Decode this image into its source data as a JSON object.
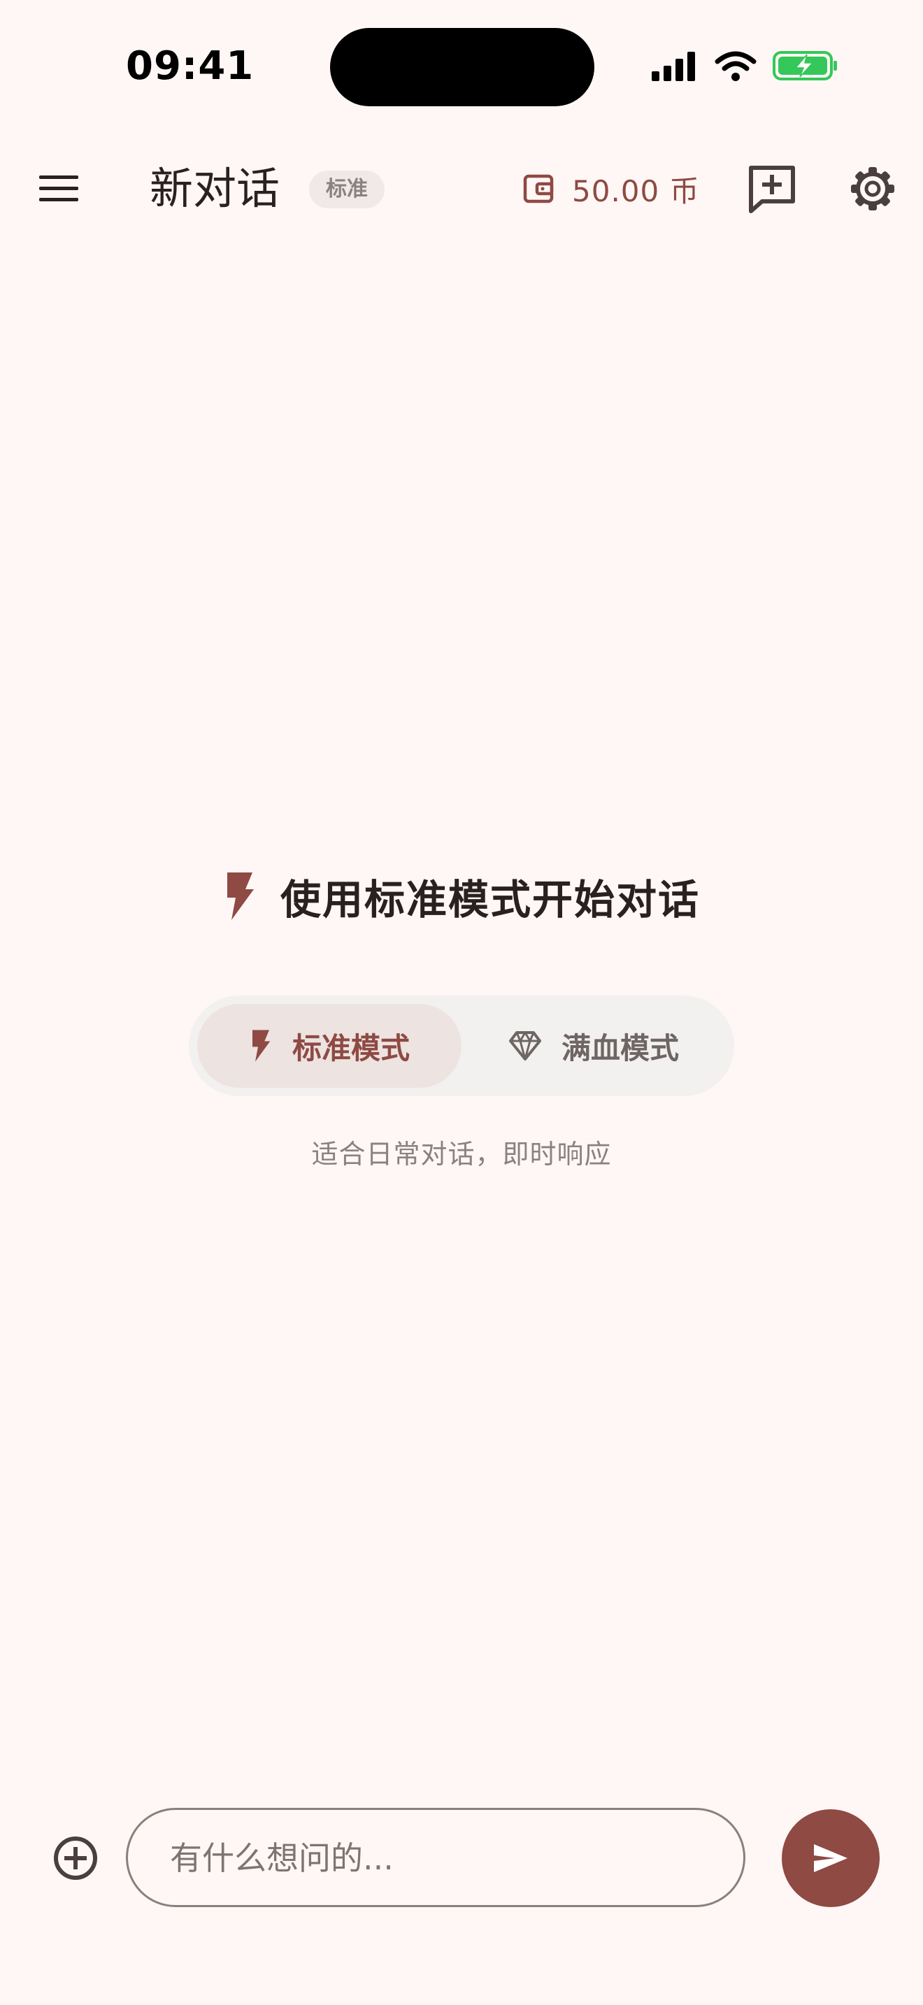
{
  "status_bar": {
    "time": "09:41"
  },
  "header": {
    "title": "新对话",
    "badge": "标准",
    "balance": "50.00 币"
  },
  "hero": {
    "text": "使用标准模式开始对话"
  },
  "mode_switch": {
    "options": [
      {
        "label": "标准模式",
        "icon": "bolt-icon",
        "active": true
      },
      {
        "label": "满血模式",
        "icon": "diamond-icon",
        "active": false
      }
    ],
    "description": "适合日常对话，即时响应"
  },
  "composer": {
    "placeholder": "有什么想问的..."
  },
  "colors": {
    "background": "#FFF7F5",
    "accent": "#8E4A43",
    "active_pill": "#EDE3E1",
    "switch_bg": "#F3F1F0",
    "battery": "#34C759"
  }
}
